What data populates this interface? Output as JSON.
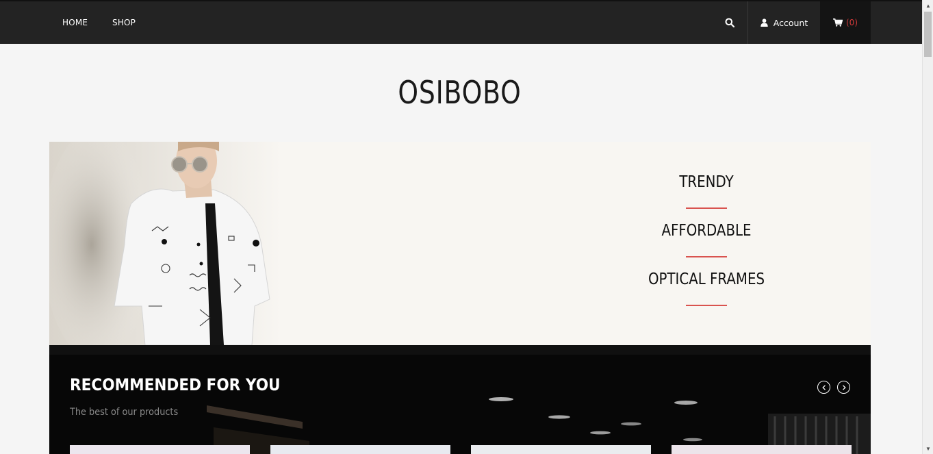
{
  "nav": {
    "home_label": "HOME",
    "shop_label": "SHOP",
    "search_icon": "search-icon",
    "account_label": "Account",
    "account_icon": "user-icon",
    "cart_icon": "cart-icon",
    "cart_count": "(0)"
  },
  "brand": {
    "logo_text": "OSIBOBO"
  },
  "hero": {
    "lines": [
      "TRENDY",
      "AFFORDABLE",
      "OPTICAL FRAMES"
    ],
    "accent_color": "#d9534f"
  },
  "recommended": {
    "title": "RECOMMENDED FOR YOU",
    "subtitle": "The best of our products",
    "prev_icon": "chevron-left-icon",
    "next_icon": "chevron-right-icon"
  },
  "colors": {
    "topbar": "#232323",
    "page_bg": "#f5f5f5",
    "cart_count": "#d23a3a"
  }
}
